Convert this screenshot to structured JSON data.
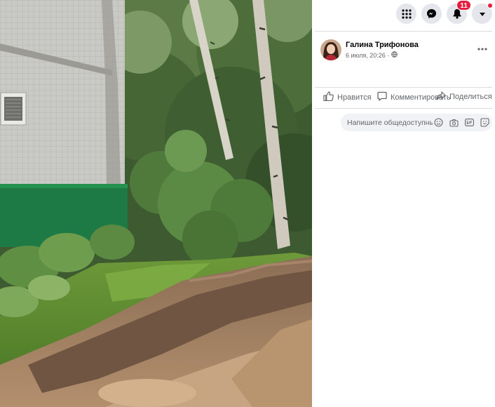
{
  "post": {
    "author": "Галина Трифонова",
    "date": "6 июля, 20:26 ·",
    "privacy_icon": "globe-icon",
    "more_icon": "more-horizontal-icon"
  },
  "topbar": {
    "menu_icon": "grid-menu-icon",
    "messenger_icon": "messenger-icon",
    "notifications_icon": "bell-icon",
    "notifications_count": "11",
    "account_icon": "caret-down-icon"
  },
  "actions": {
    "like": "Нравится",
    "comment": "Комментировать",
    "share": "Поделиться"
  },
  "comment_box": {
    "placeholder": "Напишите общедоступный комментарий...",
    "icons": [
      "emoji-icon",
      "camera-icon",
      "gif-icon",
      "sticker-icon"
    ]
  },
  "colors": {
    "accent": "#e41e3f",
    "panel_bg": "#ffffff",
    "button_bg": "#e4e6eb",
    "input_bg": "#f0f2f5",
    "secondary_text": "#65676b"
  }
}
